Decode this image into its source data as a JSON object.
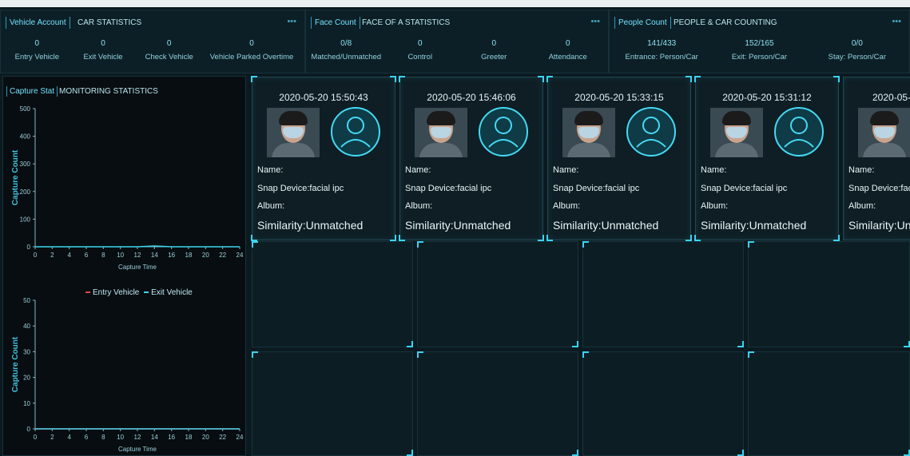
{
  "panels": [
    {
      "tag": "Vehicle Account",
      "title": "CAR STATISTICS",
      "more": "•••",
      "kpis": [
        {
          "value": "0",
          "label": "Entry Vehicle"
        },
        {
          "value": "0",
          "label": "Exit Vehicle"
        },
        {
          "value": "0",
          "label": "Check Vehicle"
        },
        {
          "value": "0",
          "label": "Vehicle Parked Overtime"
        }
      ]
    },
    {
      "tag": "Face Count",
      "title": "FACE OF A STATISTICS",
      "more": "•••",
      "kpis": [
        {
          "value": "0/8",
          "label": "Matched/Unmatched"
        },
        {
          "value": "0",
          "label": "Control"
        },
        {
          "value": "0",
          "label": "Greeter"
        },
        {
          "value": "0",
          "label": "Attendance"
        }
      ]
    },
    {
      "tag": "People Count",
      "title": "PEOPLE & CAR COUNTING",
      "more": "•••",
      "kpis": [
        {
          "value": "141/433",
          "label": "Entrance: Person/Car"
        },
        {
          "value": "152/165",
          "label": "Exit: Person/Car"
        },
        {
          "value": "0/0",
          "label": "Stay: Person/Car"
        }
      ]
    }
  ],
  "capture": {
    "tag": "Capture Stat",
    "title": "MONITORING STATISTICS"
  },
  "chart_data": [
    {
      "type": "line",
      "title": "",
      "xlabel": "Capture Time",
      "ylabel": "Capture Count",
      "xlim": [
        0,
        24
      ],
      "ylim": [
        0,
        500
      ],
      "xticks": [
        "0",
        "2",
        "4",
        "6",
        "8",
        "10",
        "12",
        "14",
        "16",
        "18",
        "20",
        "22",
        "24"
      ],
      "yticks": [
        "0",
        "100",
        "200",
        "300",
        "400",
        "500"
      ],
      "series": [
        {
          "values": [
            0,
            0,
            0,
            0,
            0,
            0,
            0,
            3,
            0,
            0,
            0,
            0,
            0
          ]
        }
      ]
    },
    {
      "type": "line",
      "title": "",
      "xlabel": "Capture Time",
      "ylabel": "Capture Count",
      "xlim": [
        0,
        24
      ],
      "ylim": [
        0,
        50
      ],
      "xticks": [
        "0",
        "2",
        "4",
        "6",
        "8",
        "10",
        "12",
        "14",
        "16",
        "18",
        "20",
        "22",
        "24"
      ],
      "yticks": [
        "0",
        "10",
        "20",
        "30",
        "40",
        "50"
      ],
      "series": [
        {
          "name": "Entry Vehicle",
          "color": "#e0454f",
          "values": [
            0,
            0,
            0,
            0,
            0,
            0,
            0,
            0,
            0,
            0,
            0,
            0,
            0
          ]
        },
        {
          "name": "Exit Vehicle",
          "color": "#3fd3ef",
          "values": [
            0,
            0,
            0,
            0,
            0,
            0,
            0,
            0,
            0,
            0,
            0,
            0,
            0
          ]
        }
      ]
    }
  ],
  "cards": [
    {
      "time": "2020-05-20 15:50:43",
      "name": "Name:",
      "device": "Snap Device:facial ipc",
      "album": "Album:",
      "similarity": "Similarity:Unmatched"
    },
    {
      "time": "2020-05-20 15:46:06",
      "name": "Name:",
      "device": "Snap Device:facial ipc",
      "album": "Album:",
      "similarity": "Similarity:Unmatched"
    },
    {
      "time": "2020-05-20 15:33:15",
      "name": "Name:",
      "device": "Snap Device:facial ipc",
      "album": "Album:",
      "similarity": "Similarity:Unmatched"
    },
    {
      "time": "2020-05-20 15:31:12",
      "name": "Name:",
      "device": "Snap Device:facial ipc",
      "album": "Album:",
      "similarity": "Similarity:Unmatched"
    },
    {
      "time": "2020-05-20",
      "name": "Name:",
      "device": "Snap Device:fac",
      "album": "Album:",
      "similarity": "Similarity:Un"
    }
  ]
}
